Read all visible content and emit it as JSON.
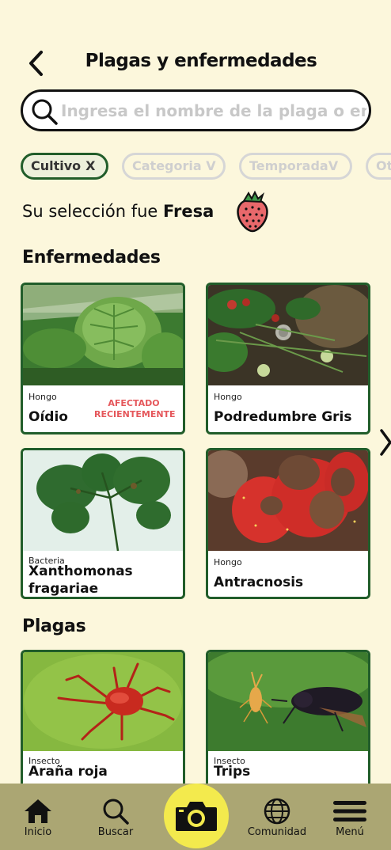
{
  "header": {
    "title": "Plagas y enfermedades"
  },
  "search": {
    "placeholder": "Ingresa el nombre de la plaga o enfermedad"
  },
  "filters": [
    {
      "label": "Cultivo",
      "suffix": "X",
      "active": true
    },
    {
      "label": "Categoria",
      "suffix": "V",
      "active": false
    },
    {
      "label": "Temporada",
      "suffix": "V",
      "active": false
    },
    {
      "label": "Ot",
      "suffix": "",
      "active": false
    }
  ],
  "selection": {
    "prefix": "Su selección fue",
    "crop": "Fresa"
  },
  "diseases": {
    "title": "Enfermedades",
    "items": [
      {
        "category": "Hongo",
        "name": "Oídio",
        "badge": "AFECTADO RECIENTEMENTE"
      },
      {
        "category": "Hongo",
        "name": "Podredumbre Gris",
        "badge": ""
      },
      {
        "category": "Bacteria",
        "name": "Xanthomonas fragariae",
        "badge": ""
      },
      {
        "category": "Hongo",
        "name": "Antracnosis",
        "badge": ""
      }
    ]
  },
  "pests": {
    "title": "Plagas",
    "items": [
      {
        "category": "Insecto",
        "name": "Araña roja"
      },
      {
        "category": "Insecto",
        "name": "Trips"
      }
    ]
  },
  "nav": {
    "home": "Inicio",
    "search": "Buscar",
    "community": "Comunidad",
    "menu": "Menú"
  },
  "colors": {
    "background": "#fcf7dc",
    "accent_green": "#215d2a",
    "nav_bar": "#aba673",
    "camera_button": "#f3ea4d",
    "badge_red": "#e5575b"
  },
  "icons": [
    "back-arrow-icon",
    "search-icon",
    "strawberry-icon",
    "chevron-right-icon",
    "home-icon",
    "camera-icon",
    "globe-icon",
    "menu-icon"
  ]
}
